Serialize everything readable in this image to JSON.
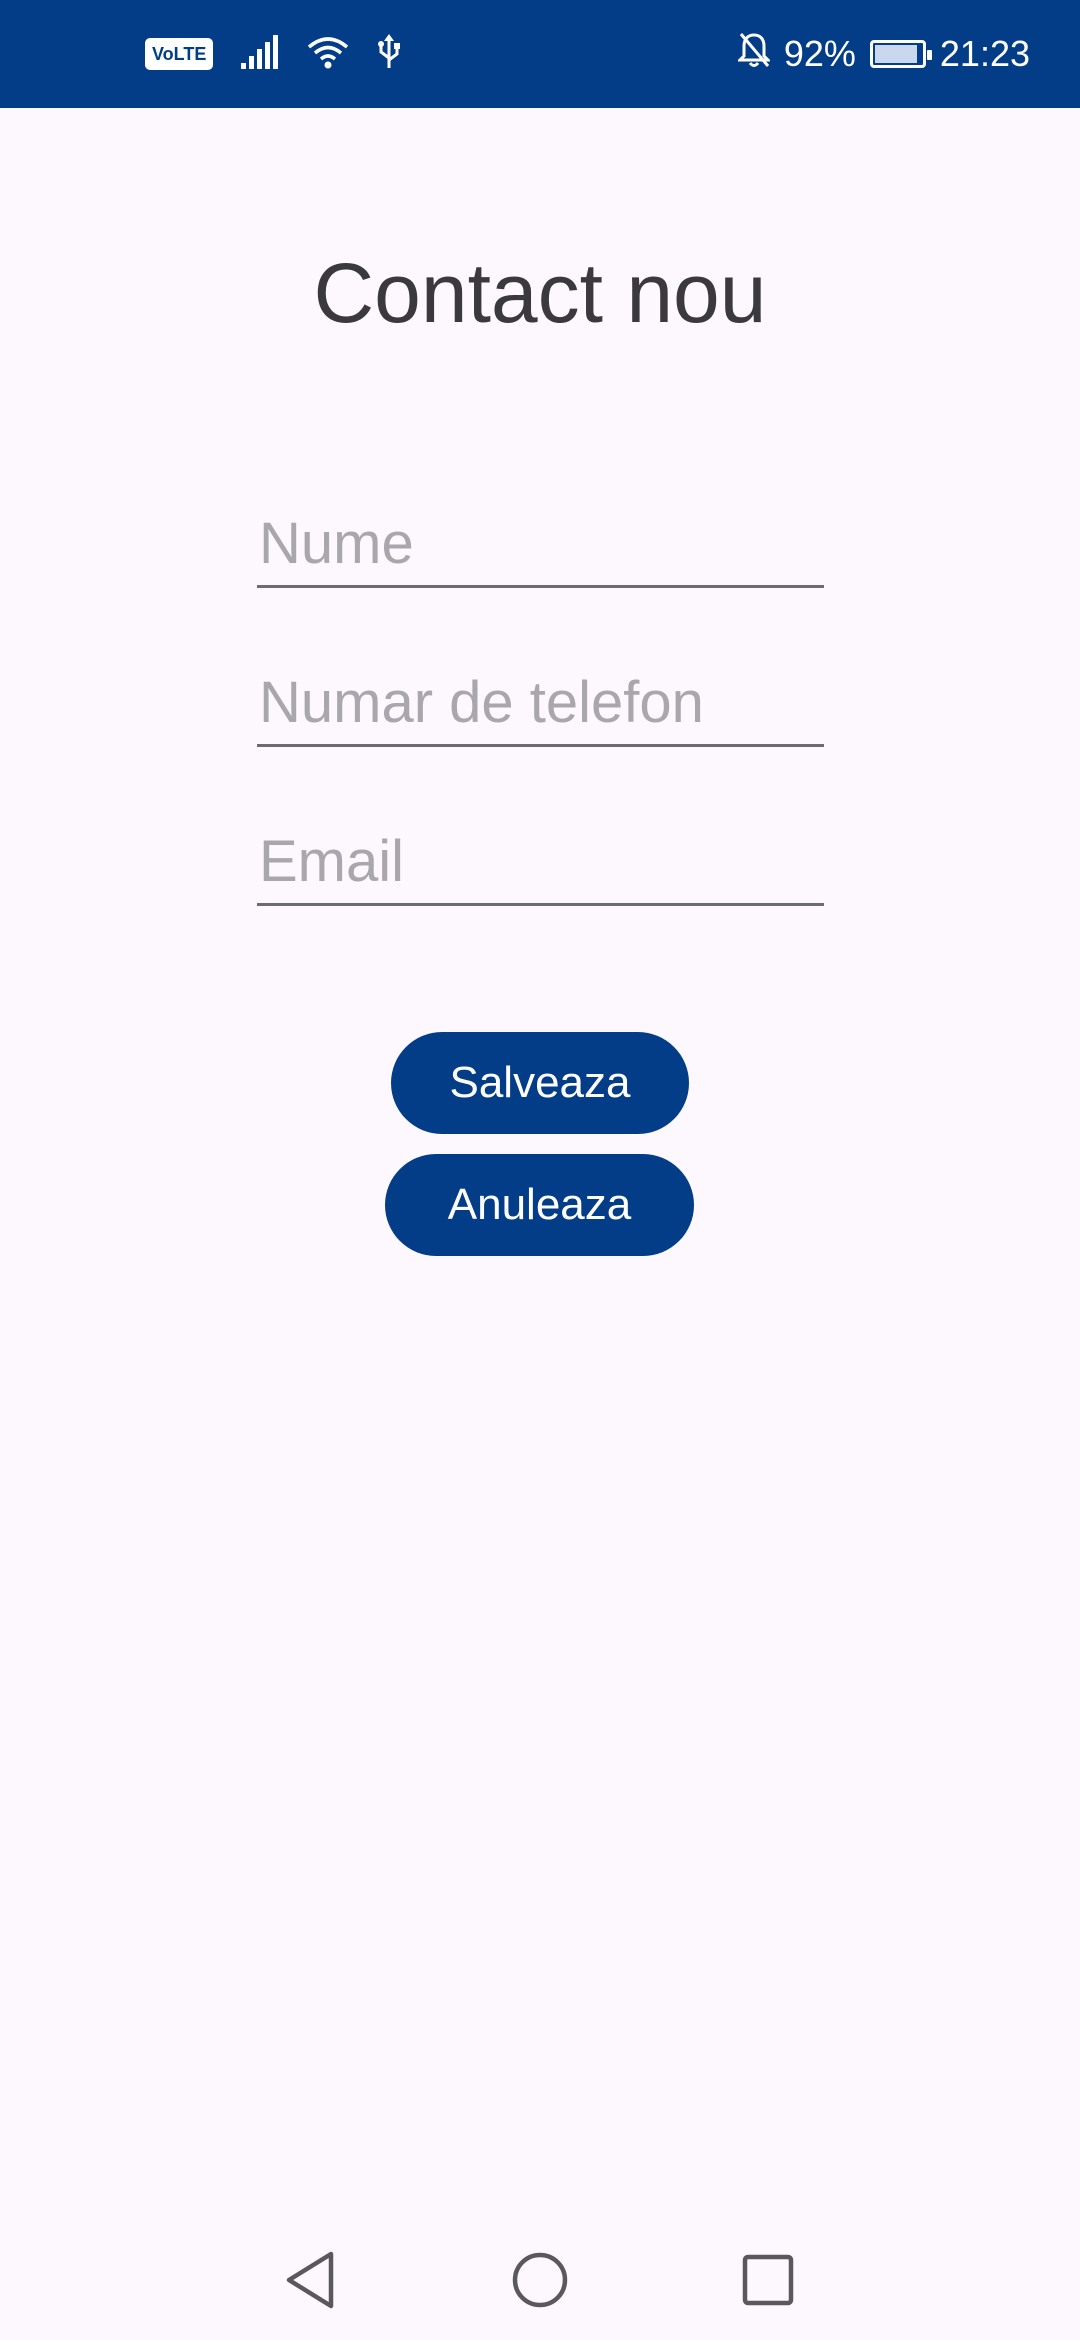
{
  "status_bar": {
    "volte": "VoLTE",
    "battery_percent": "92%",
    "battery_level": 0.92,
    "time": "21:23",
    "icons": [
      "signal-icon",
      "wifi-icon",
      "usb-icon",
      "mute-bell-icon",
      "battery-charging-icon"
    ]
  },
  "page": {
    "title": "Contact nou"
  },
  "form": {
    "name_placeholder": "Nume",
    "phone_placeholder": "Numar de telefon",
    "email_placeholder": "Email"
  },
  "buttons": {
    "save": "Salveaza",
    "cancel": "Anuleaza"
  },
  "nav": {
    "icons": [
      "back-icon",
      "home-icon",
      "recents-icon"
    ]
  },
  "colors": {
    "primary": "#033d87",
    "background": "#fdf8fe",
    "placeholder": "#a9a6ad",
    "title": "#3b393e"
  }
}
